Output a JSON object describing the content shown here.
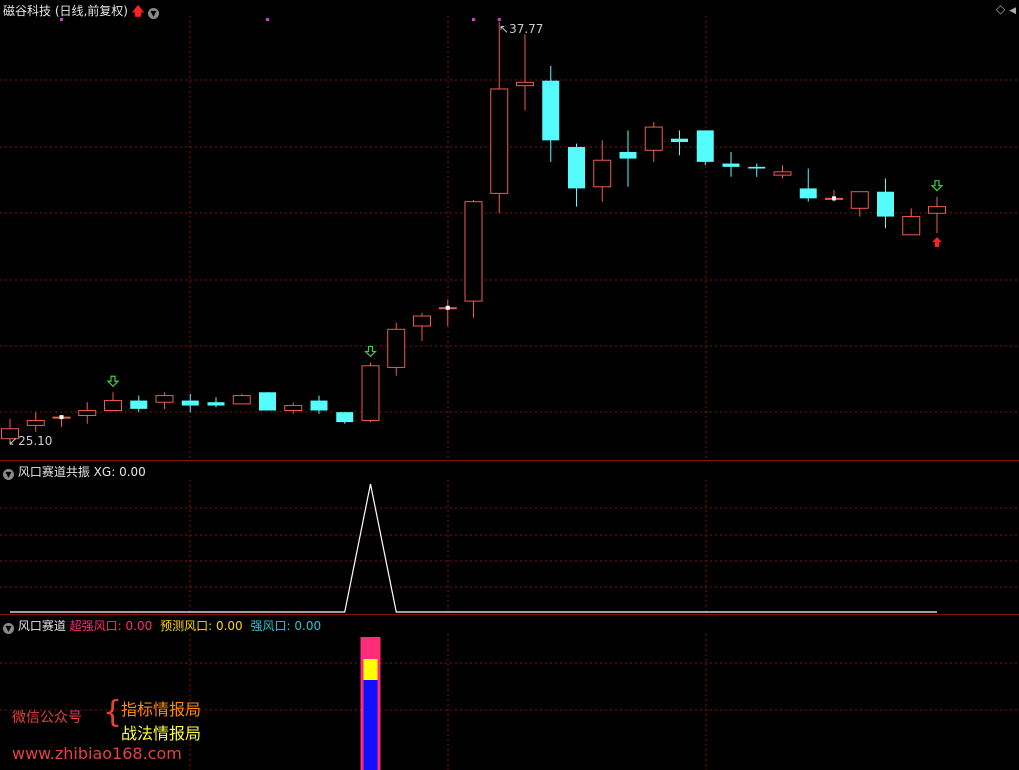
{
  "main_panel": {
    "title": "磁谷科技 (日线,前复权)",
    "high_label": "37.77",
    "low_label": "25.10"
  },
  "panel2": {
    "name": "风口赛道共振",
    "xg_label": "XG:",
    "xg_value": "0.00"
  },
  "panel3": {
    "name": "风口赛道",
    "items": [
      {
        "label": "超强风口:",
        "value": "0.00",
        "color": "#ff2d78"
      },
      {
        "label": "预测风口:",
        "value": "0.00",
        "color": "#ffd800"
      },
      {
        "label": "强风口:",
        "value": "0.00",
        "color": "#2ec4d6"
      }
    ]
  },
  "promo": {
    "main": "微信公众号",
    "line1": "指标情报局",
    "line2": "战法情报局",
    "url": "www.zhibiao168.com"
  },
  "colors": {
    "up": "#f05a50",
    "down": "#54fcfc",
    "grid": "#8a1010",
    "xg_line": "#ffffff",
    "bar_outer": "#ff2d78",
    "bar_mid": "#ffff00",
    "bar_inner": "#1010ff",
    "arrow_green": "#40d040",
    "arrow_red": "#ff2020"
  },
  "chart_data": {
    "type": "candlestick",
    "ylim": [
      25.1,
      37.77
    ],
    "candles": [
      {
        "o": 25.2,
        "c": 25.5,
        "h": 25.8,
        "l": 25.1
      },
      {
        "o": 25.6,
        "c": 25.75,
        "h": 26.0,
        "l": 25.4
      },
      {
        "o": 25.85,
        "c": 25.85,
        "h": 25.9,
        "l": 25.55
      },
      {
        "o": 25.9,
        "c": 26.05,
        "h": 26.3,
        "l": 25.65
      },
      {
        "o": 26.05,
        "c": 26.35,
        "h": 26.6,
        "l": 26.05
      },
      {
        "o": 26.35,
        "c": 26.1,
        "h": 26.5,
        "l": 26.0
      },
      {
        "o": 26.3,
        "c": 26.5,
        "h": 26.6,
        "l": 26.1
      },
      {
        "o": 26.35,
        "c": 26.2,
        "h": 26.55,
        "l": 26.0
      },
      {
        "o": 26.3,
        "c": 26.2,
        "h": 26.45,
        "l": 26.15
      },
      {
        "o": 26.25,
        "c": 26.5,
        "h": 26.55,
        "l": 26.25
      },
      {
        "o": 26.6,
        "c": 26.05,
        "h": 26.6,
        "l": 26.05
      },
      {
        "o": 26.05,
        "c": 26.2,
        "h": 26.3,
        "l": 25.95
      },
      {
        "o": 26.35,
        "c": 26.05,
        "h": 26.5,
        "l": 25.95
      },
      {
        "o": 26.0,
        "c": 25.7,
        "h": 26.0,
        "l": 25.65
      },
      {
        "o": 25.75,
        "c": 27.4,
        "h": 27.5,
        "l": 25.7
      },
      {
        "o": 27.35,
        "c": 28.5,
        "h": 28.7,
        "l": 27.1
      },
      {
        "o": 28.6,
        "c": 28.9,
        "h": 29.0,
        "l": 28.15
      },
      {
        "o": 29.15,
        "c": 29.15,
        "h": 29.4,
        "l": 28.6
      },
      {
        "o": 29.35,
        "c": 32.35,
        "h": 32.4,
        "l": 28.85
      },
      {
        "o": 32.6,
        "c": 35.75,
        "h": 37.77,
        "l": 32.0
      },
      {
        "o": 35.85,
        "c": 35.95,
        "h": 37.4,
        "l": 35.1
      },
      {
        "o": 36.0,
        "c": 34.2,
        "h": 36.45,
        "l": 33.55
      },
      {
        "o": 34.0,
        "c": 32.75,
        "h": 34.1,
        "l": 32.2
      },
      {
        "o": 32.8,
        "c": 33.6,
        "h": 34.2,
        "l": 32.35
      },
      {
        "o": 33.85,
        "c": 33.65,
        "h": 34.5,
        "l": 32.8
      },
      {
        "o": 33.9,
        "c": 34.6,
        "h": 34.75,
        "l": 33.55
      },
      {
        "o": 34.25,
        "c": 34.15,
        "h": 34.5,
        "l": 33.75
      },
      {
        "o": 34.5,
        "c": 33.55,
        "h": 34.5,
        "l": 33.45
      },
      {
        "o": 33.5,
        "c": 33.4,
        "h": 33.85,
        "l": 33.1
      },
      {
        "o": 33.4,
        "c": 33.35,
        "h": 33.5,
        "l": 33.1
      },
      {
        "o": 33.15,
        "c": 33.25,
        "h": 33.45,
        "l": 33.05
      },
      {
        "o": 32.75,
        "c": 32.45,
        "h": 33.35,
        "l": 32.35
      },
      {
        "o": 32.45,
        "c": 32.45,
        "h": 32.7,
        "l": 32.35
      },
      {
        "o": 32.15,
        "c": 32.65,
        "h": 32.65,
        "l": 31.9
      },
      {
        "o": 32.65,
        "c": 31.9,
        "h": 33.05,
        "l": 31.55
      },
      {
        "o": 31.35,
        "c": 31.9,
        "h": 32.15,
        "l": 31.35
      },
      {
        "o": 32.0,
        "c": 32.2,
        "h": 32.5,
        "l": 31.4
      }
    ],
    "green_arrows": [
      4,
      14,
      36
    ],
    "red_arrows": [
      36
    ],
    "top_dots": [
      2,
      10,
      18,
      19
    ],
    "xg_series": [
      0,
      0,
      0,
      0,
      0,
      0,
      0,
      0,
      0,
      0,
      0,
      0,
      0,
      0,
      1,
      0,
      0,
      0,
      0,
      0,
      0,
      0,
      0,
      0,
      0,
      0,
      0,
      0,
      0,
      0,
      0,
      0,
      0,
      0,
      0,
      0,
      0
    ],
    "xg_ylim": [
      0,
      1
    ],
    "signal_bar_index": 14
  }
}
